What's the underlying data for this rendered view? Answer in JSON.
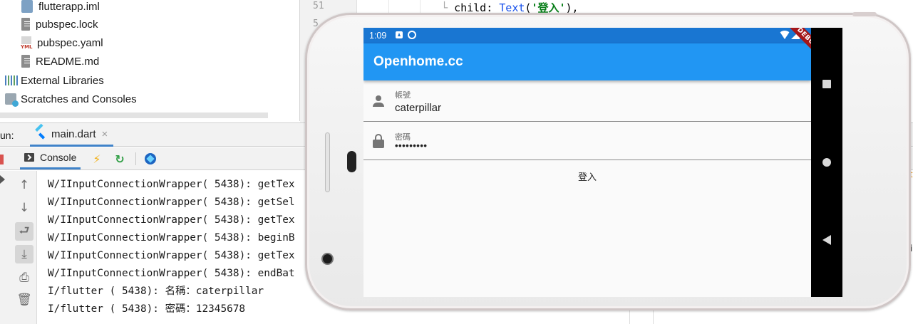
{
  "project_tree": {
    "items": [
      {
        "label": "flutterapp.iml",
        "icon": "iml-file-icon"
      },
      {
        "label": "pubspec.lock",
        "icon": "text-file-icon"
      },
      {
        "label": "pubspec.yaml",
        "icon": "yaml-file-icon"
      },
      {
        "label": "README.md",
        "icon": "markdown-file-icon"
      },
      {
        "label": "External Libraries",
        "icon": "libraries-icon"
      },
      {
        "label": "Scratches and Consoles",
        "icon": "scratches-icon"
      }
    ]
  },
  "editor": {
    "line_numbers": [
      "51",
      "5"
    ],
    "code": {
      "prefix": "child: ",
      "call": "Text",
      "open": "(",
      "string": "'登入'",
      "close": "),"
    }
  },
  "run_window": {
    "label": "un:",
    "tab_label": "main.dart",
    "close_glyph": "×",
    "console_tab": "Console",
    "hot_reload_glyph": "⚡",
    "hot_restart_glyph": "↻"
  },
  "sidebar_glyphs": {
    "up": "↑",
    "down": "↓",
    "soft_wrap": "⮐",
    "scroll_end": "⤓",
    "print": "⎙",
    "trash": "🗑"
  },
  "console": {
    "lines": [
      "W/IInputConnectionWrapper( 5438): getTex",
      "W/IInputConnectionWrapper( 5438): getSel",
      "W/IInputConnectionWrapper( 5438): getTex",
      "W/IInputConnectionWrapper( 5438): beginB",
      "W/IInputConnectionWrapper( 5438): getTex",
      "W/IInputConnectionWrapper( 5438): endBat",
      "I/flutter ( 5438): 名稱：caterpillar",
      "I/flutter ( 5438): 密碼：12345678"
    ]
  },
  "phone": {
    "status_time": "1:09",
    "debug_banner": "DEBUG",
    "app_title": "Openhome.cc",
    "account": {
      "label": "帳號",
      "value": "caterpillar"
    },
    "password": {
      "label": "密碼",
      "value": "•••••••••"
    },
    "login_button": "登入",
    "colors": {
      "status_bar": "#1976d2",
      "app_bar": "#2196f3",
      "debug": "#a4161a"
    }
  },
  "edge_marks": {
    "orange": "t",
    "black": "i"
  }
}
